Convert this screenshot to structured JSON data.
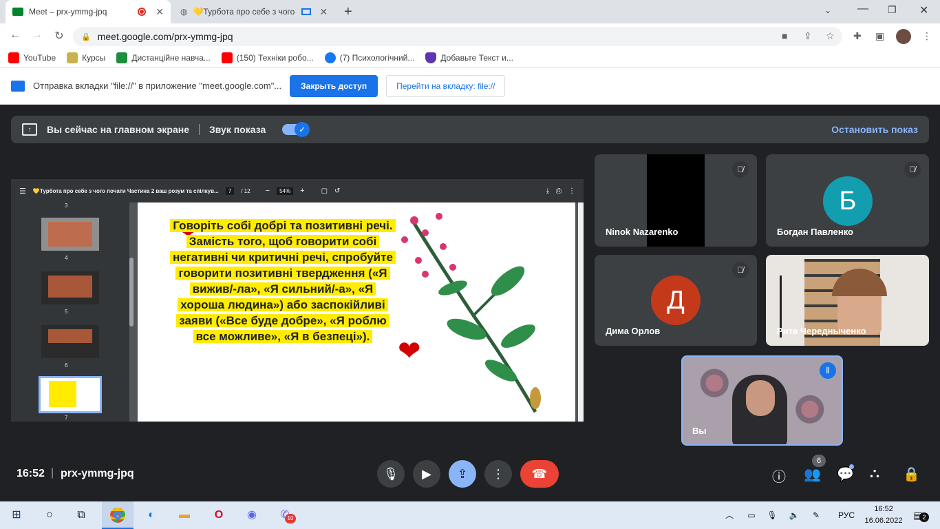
{
  "browser": {
    "tabs": [
      {
        "title": "Meet – prx-ymmg-jpq"
      },
      {
        "title": "💛Турбота про себе з чого"
      }
    ],
    "url": "meet.google.com/prx-ymmg-jpq",
    "bookmarks": [
      "YouTube",
      "Курсы",
      "Дистанційне навча...",
      "(150) Техніки робо...",
      "(7) Психологічний...",
      "Добавьте Текст и..."
    ],
    "infobar": {
      "message": "Отправка вкладки \"file://\" в приложение \"meet.google.com\"...",
      "primary": "Закрыть доступ",
      "secondary": "Перейти на вкладку: file://"
    }
  },
  "meet": {
    "presenting": {
      "status": "Вы сейчас на главном экране",
      "sound": "Звук показа",
      "stop": "Остановить показ"
    },
    "pdf": {
      "title": "💛Турбота про себе з чого почати Частина 2 ваш розум та спілкув...",
      "page": "7",
      "pages": "/ 12",
      "zoom": "54%",
      "thumb_nums": [
        "3",
        "4",
        "5",
        "6",
        "7"
      ],
      "body": "Говоріть собі добрі та позитивні речі. Замість того, щоб говорити собі негативні чи критичні речі, спробуйте говорити позитивні твердження («Я вижив/-ла», «Я сильний/-а», «Я хороша людина») або заспокійливі заяви («Все буде добре», «Я роблю все можливе», «Я в безпеці»)."
    },
    "participants": [
      {
        "name": "Ninok Nazarenko"
      },
      {
        "name": "Богдан Павленко",
        "initial": "Б",
        "color": "#129eaf"
      },
      {
        "name": "Дима Орлов",
        "initial": "Д",
        "color": "#c5391b"
      },
      {
        "name": "Рита Чередныченко"
      },
      {
        "name": "Вы"
      }
    ],
    "time": "16:52",
    "code": "prx-ymmg-jpq",
    "people_count": "6"
  },
  "taskbar": {
    "lang": "РУС",
    "time": "16:52",
    "date": "16.06.2022",
    "notif": "2",
    "viber_badge": "10"
  }
}
